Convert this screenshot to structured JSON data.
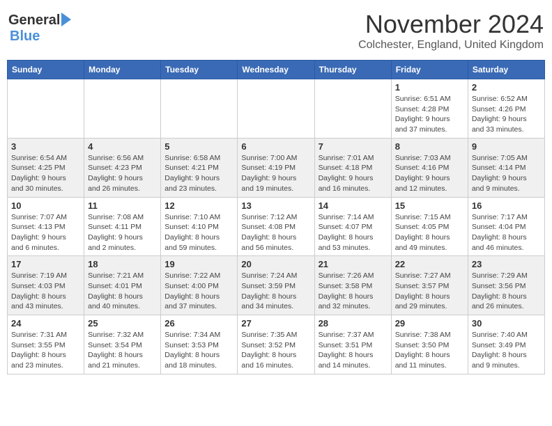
{
  "header": {
    "logo_general": "General",
    "logo_blue": "Blue",
    "month_year": "November 2024",
    "location": "Colchester, England, United Kingdom"
  },
  "days_of_week": [
    "Sunday",
    "Monday",
    "Tuesday",
    "Wednesday",
    "Thursday",
    "Friday",
    "Saturday"
  ],
  "weeks": [
    [
      {
        "day": "",
        "info": ""
      },
      {
        "day": "",
        "info": ""
      },
      {
        "day": "",
        "info": ""
      },
      {
        "day": "",
        "info": ""
      },
      {
        "day": "",
        "info": ""
      },
      {
        "day": "1",
        "info": "Sunrise: 6:51 AM\nSunset: 4:28 PM\nDaylight: 9 hours\nand 37 minutes."
      },
      {
        "day": "2",
        "info": "Sunrise: 6:52 AM\nSunset: 4:26 PM\nDaylight: 9 hours\nand 33 minutes."
      }
    ],
    [
      {
        "day": "3",
        "info": "Sunrise: 6:54 AM\nSunset: 4:25 PM\nDaylight: 9 hours\nand 30 minutes."
      },
      {
        "day": "4",
        "info": "Sunrise: 6:56 AM\nSunset: 4:23 PM\nDaylight: 9 hours\nand 26 minutes."
      },
      {
        "day": "5",
        "info": "Sunrise: 6:58 AM\nSunset: 4:21 PM\nDaylight: 9 hours\nand 23 minutes."
      },
      {
        "day": "6",
        "info": "Sunrise: 7:00 AM\nSunset: 4:19 PM\nDaylight: 9 hours\nand 19 minutes."
      },
      {
        "day": "7",
        "info": "Sunrise: 7:01 AM\nSunset: 4:18 PM\nDaylight: 9 hours\nand 16 minutes."
      },
      {
        "day": "8",
        "info": "Sunrise: 7:03 AM\nSunset: 4:16 PM\nDaylight: 9 hours\nand 12 minutes."
      },
      {
        "day": "9",
        "info": "Sunrise: 7:05 AM\nSunset: 4:14 PM\nDaylight: 9 hours\nand 9 minutes."
      }
    ],
    [
      {
        "day": "10",
        "info": "Sunrise: 7:07 AM\nSunset: 4:13 PM\nDaylight: 9 hours\nand 6 minutes."
      },
      {
        "day": "11",
        "info": "Sunrise: 7:08 AM\nSunset: 4:11 PM\nDaylight: 9 hours\nand 2 minutes."
      },
      {
        "day": "12",
        "info": "Sunrise: 7:10 AM\nSunset: 4:10 PM\nDaylight: 8 hours\nand 59 minutes."
      },
      {
        "day": "13",
        "info": "Sunrise: 7:12 AM\nSunset: 4:08 PM\nDaylight: 8 hours\nand 56 minutes."
      },
      {
        "day": "14",
        "info": "Sunrise: 7:14 AM\nSunset: 4:07 PM\nDaylight: 8 hours\nand 53 minutes."
      },
      {
        "day": "15",
        "info": "Sunrise: 7:15 AM\nSunset: 4:05 PM\nDaylight: 8 hours\nand 49 minutes."
      },
      {
        "day": "16",
        "info": "Sunrise: 7:17 AM\nSunset: 4:04 PM\nDaylight: 8 hours\nand 46 minutes."
      }
    ],
    [
      {
        "day": "17",
        "info": "Sunrise: 7:19 AM\nSunset: 4:03 PM\nDaylight: 8 hours\nand 43 minutes."
      },
      {
        "day": "18",
        "info": "Sunrise: 7:21 AM\nSunset: 4:01 PM\nDaylight: 8 hours\nand 40 minutes."
      },
      {
        "day": "19",
        "info": "Sunrise: 7:22 AM\nSunset: 4:00 PM\nDaylight: 8 hours\nand 37 minutes."
      },
      {
        "day": "20",
        "info": "Sunrise: 7:24 AM\nSunset: 3:59 PM\nDaylight: 8 hours\nand 34 minutes."
      },
      {
        "day": "21",
        "info": "Sunrise: 7:26 AM\nSunset: 3:58 PM\nDaylight: 8 hours\nand 32 minutes."
      },
      {
        "day": "22",
        "info": "Sunrise: 7:27 AM\nSunset: 3:57 PM\nDaylight: 8 hours\nand 29 minutes."
      },
      {
        "day": "23",
        "info": "Sunrise: 7:29 AM\nSunset: 3:56 PM\nDaylight: 8 hours\nand 26 minutes."
      }
    ],
    [
      {
        "day": "24",
        "info": "Sunrise: 7:31 AM\nSunset: 3:55 PM\nDaylight: 8 hours\nand 23 minutes."
      },
      {
        "day": "25",
        "info": "Sunrise: 7:32 AM\nSunset: 3:54 PM\nDaylight: 8 hours\nand 21 minutes."
      },
      {
        "day": "26",
        "info": "Sunrise: 7:34 AM\nSunset: 3:53 PM\nDaylight: 8 hours\nand 18 minutes."
      },
      {
        "day": "27",
        "info": "Sunrise: 7:35 AM\nSunset: 3:52 PM\nDaylight: 8 hours\nand 16 minutes."
      },
      {
        "day": "28",
        "info": "Sunrise: 7:37 AM\nSunset: 3:51 PM\nDaylight: 8 hours\nand 14 minutes."
      },
      {
        "day": "29",
        "info": "Sunrise: 7:38 AM\nSunset: 3:50 PM\nDaylight: 8 hours\nand 11 minutes."
      },
      {
        "day": "30",
        "info": "Sunrise: 7:40 AM\nSunset: 3:49 PM\nDaylight: 8 hours\nand 9 minutes."
      }
    ]
  ]
}
